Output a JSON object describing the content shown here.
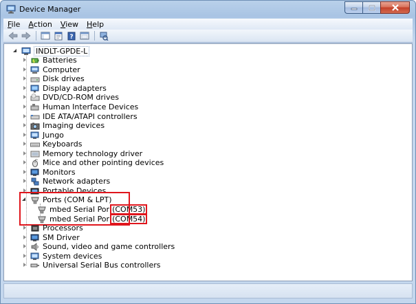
{
  "window": {
    "title": "Device Manager"
  },
  "menu": {
    "items": [
      {
        "mnemonic": "F",
        "rest": "ile"
      },
      {
        "mnemonic": "A",
        "rest": "ction"
      },
      {
        "mnemonic": "V",
        "rest": "iew"
      },
      {
        "mnemonic": "H",
        "rest": "elp"
      }
    ]
  },
  "tree": {
    "root": "INDLT-GPDE-L",
    "categories": [
      "Batteries",
      "Computer",
      "Disk drives",
      "Display adapters",
      "DVD/CD-ROM drives",
      "Human Interface Devices",
      "IDE ATA/ATAPI controllers",
      "Imaging devices",
      "Jungo",
      "Keyboards",
      "Memory technology driver",
      "Mice and other pointing devices",
      "Monitors",
      "Network adapters",
      "Portable Devices"
    ],
    "ports": {
      "label": "Ports (COM & LPT)",
      "devices": [
        {
          "name": "mbed Serial Por",
          "port": "(COM53)"
        },
        {
          "name": "mbed Serial Por",
          "port": "(COM54)"
        }
      ]
    },
    "after": [
      "Processors",
      "SM Driver",
      "Sound, video and game controllers",
      "System devices",
      "Universal Serial Bus controllers"
    ]
  },
  "colors": {
    "highlight": "#e0151c",
    "titlebar": "#b9d1ea"
  }
}
